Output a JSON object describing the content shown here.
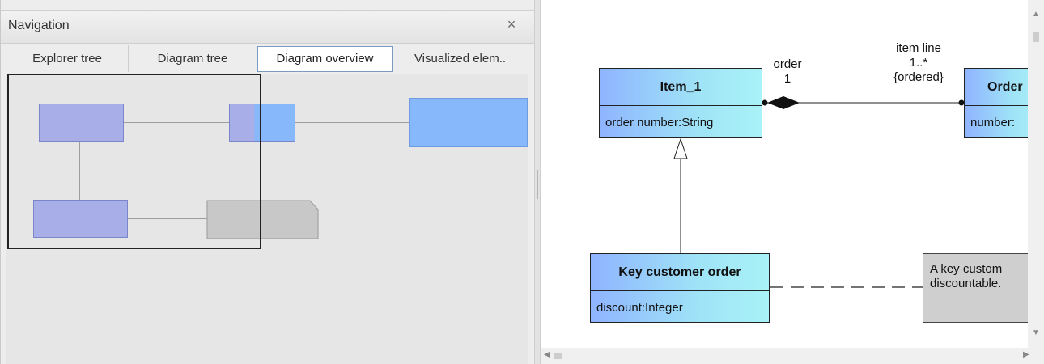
{
  "navigation": {
    "title": "Navigation",
    "close_icon": "×",
    "tabs": [
      {
        "label": "Explorer tree"
      },
      {
        "label": "Diagram tree"
      },
      {
        "label": "Diagram overview",
        "active": true
      },
      {
        "label": "Visualized elem.."
      }
    ]
  },
  "diagram": {
    "classes": {
      "item": {
        "name": "Item_1",
        "attribute": "order number:String"
      },
      "order": {
        "name": "Order",
        "attribute": "number:"
      },
      "key_customer_order": {
        "name": "Key customer order",
        "attribute": "discount:Integer"
      }
    },
    "association": {
      "source_role": "order",
      "source_multiplicity": "1",
      "target_role": "item line",
      "target_multiplicity": "1..*",
      "target_constraint": "{ordered}"
    },
    "note": {
      "line1": "A key custom",
      "line2": "discountable."
    }
  },
  "scrollbars": {
    "up_arrow": "▲",
    "down_arrow": "▼",
    "left_arrow": "◀",
    "right_arrow": "▶"
  },
  "colors": {
    "class_gradient_start": "#8fb4ff",
    "class_gradient_end": "#a9f2f7",
    "note_fill": "#cfcfcf",
    "overview_fill_blue": "#a7aee8",
    "overview_fill_lightblue": "#86b8fb"
  }
}
